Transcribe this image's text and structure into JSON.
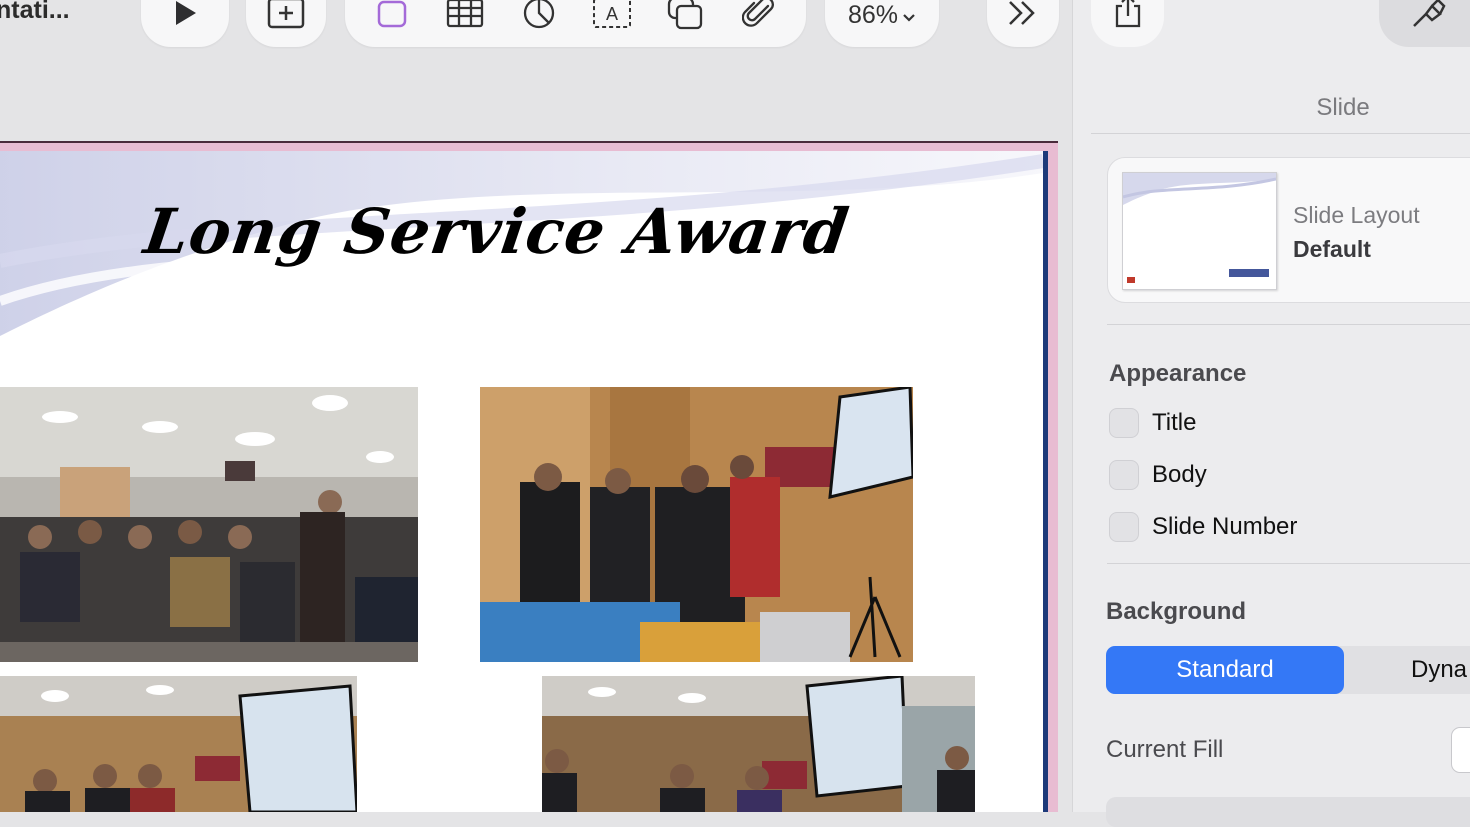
{
  "toolbar": {
    "document_title": "ntati...",
    "zoom_label": "86%",
    "icons": [
      "play-icon",
      "add-slide-icon",
      "shape-icon",
      "table-icon",
      "chart-icon",
      "text-icon",
      "layers-icon",
      "attachment-icon",
      "more-icon",
      "share-icon",
      "format-icon"
    ]
  },
  "slide": {
    "title": "Long Service Award"
  },
  "inspector": {
    "tab_label": "Slide",
    "layout_label": "Slide Layout",
    "layout_value": "Default",
    "appearance_heading": "Appearance",
    "appearance_items": [
      {
        "label": "Title",
        "checked": false
      },
      {
        "label": "Body",
        "checked": false
      },
      {
        "label": "Slide Number",
        "checked": false
      }
    ],
    "background_heading": "Background",
    "background_options": [
      "Standard",
      "Dyna"
    ],
    "background_selected": "Standard",
    "current_fill_label": "Current Fill"
  },
  "colors": {
    "accent": "#3478f6",
    "shape_icon": "#a46ad8",
    "slide_frame": "#e8bcd2",
    "slide_edge": "#1d3a7a"
  }
}
